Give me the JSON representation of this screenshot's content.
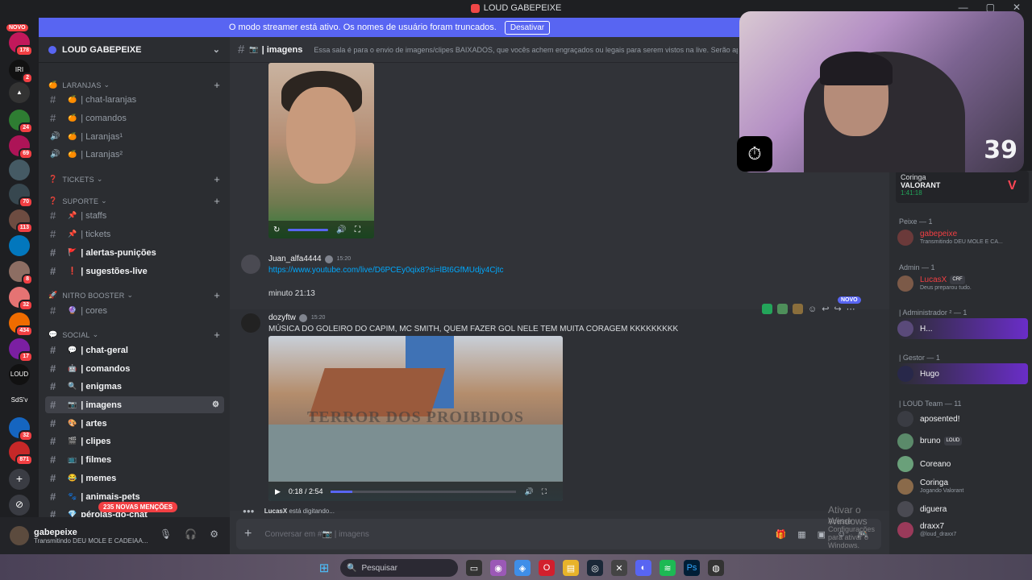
{
  "window": {
    "title": "LOUD GABEPEIXE"
  },
  "banner": {
    "text": "O modo streamer está ativo. Os nomes de usuário foram truncados.",
    "button": "Desativar"
  },
  "guilds": {
    "novo": "NOVO",
    "items": [
      {
        "badge": "178",
        "color": "#c2185b"
      },
      {
        "badge": "2",
        "color": "#111",
        "label": "IRI"
      },
      {
        "badge": "",
        "color": "#333",
        "label": "▲"
      },
      {
        "badge": "24",
        "color": "#2e7d32"
      },
      {
        "badge": "69",
        "color": "#ad1457"
      },
      {
        "badge": "",
        "color": "#455a64"
      },
      {
        "badge": "70",
        "color": "#37474f"
      },
      {
        "badge": "113",
        "color": "#6d4c41"
      },
      {
        "badge": "",
        "color": "#0277bd"
      },
      {
        "badge": "8",
        "color": "#8d6e63"
      },
      {
        "badge": "32",
        "color": "#e57373"
      },
      {
        "badge": "434",
        "color": "#ef6c00"
      },
      {
        "badge": "17",
        "color": "#7b1fa2"
      },
      {
        "badge": "",
        "color": "#111",
        "label": "LOUD"
      },
      {
        "badge": "",
        "color": "#1e1f22",
        "label": "SdS'v"
      },
      {
        "badge": "32",
        "color": "#1565c0"
      },
      {
        "badge": "871",
        "color": "#c62828"
      }
    ],
    "add_label": "+",
    "explore_label": "⊘"
  },
  "server": {
    "name": "LOUD GABEPEIXE"
  },
  "categories": [
    {
      "name": "LARANJAS",
      "emoji": "🍊"
    },
    {
      "name": "TICKETS",
      "emoji": "❓"
    },
    {
      "name": "SUPORTE",
      "emoji": "❓"
    },
    {
      "name": "NITRO BOOSTER",
      "emoji": "🚀"
    },
    {
      "name": "SOCIAL",
      "emoji": "💬"
    }
  ],
  "channels": [
    {
      "label": "| chat-laranjas",
      "emoji": "🍊",
      "state": "normal"
    },
    {
      "label": "| comandos",
      "emoji": "🍊",
      "state": "normal"
    },
    {
      "label": "| Laranjas¹",
      "emoji": "🍊",
      "state": "voice"
    },
    {
      "label": "| Laranjas²",
      "emoji": "🍊",
      "state": "voice"
    },
    {
      "label": "| staffs",
      "emoji": "📌",
      "state": "normal"
    },
    {
      "label": "| tickets",
      "emoji": "📌",
      "state": "normal"
    },
    {
      "label": "| alertas-punições",
      "emoji": "🚩",
      "state": "unread"
    },
    {
      "label": "| sugestões-live",
      "emoji": "❗",
      "state": "unread"
    },
    {
      "label": "| cores",
      "emoji": "🔮",
      "state": "normal"
    },
    {
      "label": "| chat-geral",
      "emoji": "💬",
      "state": "unread"
    },
    {
      "label": "| comandos",
      "emoji": "🤖",
      "state": "unread"
    },
    {
      "label": "| enigmas",
      "emoji": "🔍",
      "state": "unread"
    },
    {
      "label": "| imagens",
      "emoji": "📷",
      "state": "active"
    },
    {
      "label": "| artes",
      "emoji": "🎨",
      "state": "unread"
    },
    {
      "label": "| clipes",
      "emoji": "🎬",
      "state": "unread"
    },
    {
      "label": "| filmes",
      "emoji": "📺",
      "state": "unread"
    },
    {
      "label": "| memes",
      "emoji": "😂",
      "state": "unread"
    },
    {
      "label": "| animais-pets",
      "emoji": "🐾",
      "state": "unread"
    },
    {
      "label": "pérolas-do-chat",
      "emoji": "💎",
      "state": "unread"
    }
  ],
  "mentions_pill": "235 NOVAS MENÇÕES",
  "user": {
    "name": "gabepeixe",
    "status": "Transmitindo DEU MOLE E CADEIAA..."
  },
  "chat": {
    "channel": "| imagens",
    "topic": "Essa sala é para o envio de imagens/clipes BAIXADOS, que vocês achem engraçados ou legais para serem vistos na live. Serão apag",
    "messages": [
      {
        "author": "Juan_alfa4444",
        "time": "15:20",
        "link": "https://www.youtube.com/live/D6PCEy0qix8?si=lBt6GfMUdjy4Cjtc",
        "text": "minuto 21:13"
      },
      {
        "author": "dozyftw",
        "time": "15:20",
        "text": "MÚSICA DO GOLEIRO DO CAPIM, MC SMITH, QUEM FAZER GOL NELE TEM MUITA CORAGEM KKKKKKKKK"
      }
    ],
    "novo_tag": "NOVO",
    "video": {
      "watermark": "TERROR DOS PROIBIDOS",
      "time": "0:18 / 2:54",
      "progress": 0.115
    },
    "typing_user": "LucasX",
    "typing_text": "está digitando...",
    "composer_placeholder": "Conversar em #📷 | imagens"
  },
  "windows_watermark": {
    "title": "Ativar o Windows",
    "subtitle": "Acesse Configurações para ativar o Windows."
  },
  "members": {
    "game_card": {
      "name": "Coringa",
      "game": "VALORANT",
      "time": "1:41:18"
    },
    "groups": [
      {
        "title": "Peixe — 1",
        "members": [
          {
            "name": "gabepeixe",
            "status": "Transmitindo DEU MOLE E CA...",
            "color": "#f23f43"
          }
        ]
      },
      {
        "title": "Admin — 1",
        "members": [
          {
            "name": "LucasX",
            "tag": "CRF",
            "status": "Deus preparou tudo.",
            "color": "#f23f43"
          }
        ]
      },
      {
        "title": "| Administrador ² — 1",
        "members": [
          {
            "name": "H...",
            "status": "",
            "color": "#f2f3f5"
          }
        ]
      },
      {
        "title": "| Gestor — 1",
        "members": [
          {
            "name": "Hugo",
            "status": "",
            "color": "#f2f3f5"
          }
        ]
      },
      {
        "title": "| LOUD Team — 11",
        "members": [
          {
            "name": "aposented!",
            "status": "",
            "color": "#f2f3f5"
          },
          {
            "name": "bruno",
            "tag": "LOUD",
            "status": "",
            "color": "#f2f3f5"
          },
          {
            "name": "Coreano",
            "status": "",
            "color": "#f2f3f5"
          },
          {
            "name": "Coringa",
            "status": "Jogando Valorant",
            "color": "#f2f3f5"
          },
          {
            "name": "diguera",
            "status": "",
            "color": "#f2f3f5"
          },
          {
            "name": "draxx7",
            "status": "@loud_draxx7",
            "color": "#f2f3f5"
          }
        ]
      }
    ]
  },
  "webcam": {
    "overlay_number": "39"
  },
  "taskbar": {
    "search_placeholder": "Pesquisar"
  }
}
